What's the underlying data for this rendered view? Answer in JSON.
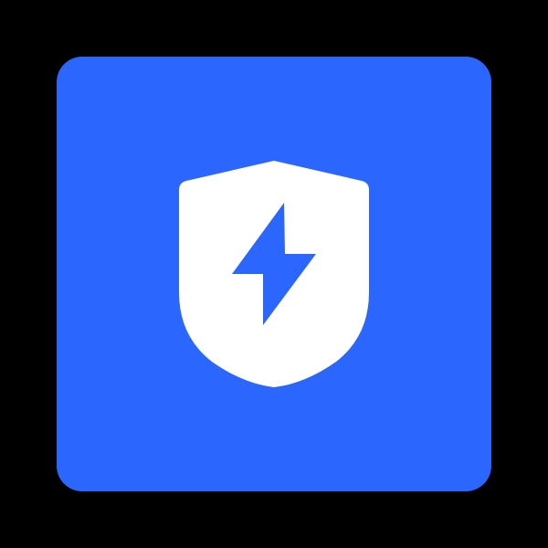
{
  "app_icon": {
    "name": "shield-bolt",
    "background_color": "#2A66FF",
    "shield_color": "#FFFFFF",
    "bolt_color": "#2A66FF",
    "page_background": "#000000"
  }
}
